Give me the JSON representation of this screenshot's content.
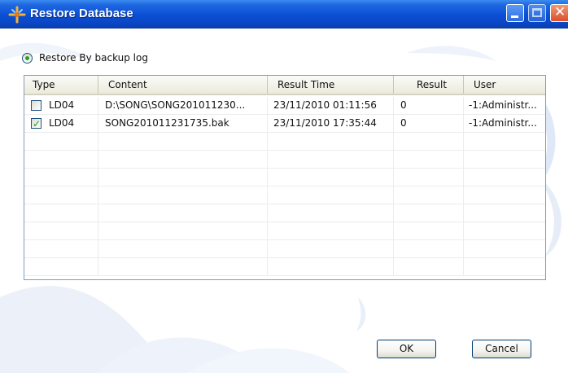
{
  "window": {
    "title": "Restore Database",
    "icon": "restore-database-icon",
    "controls": [
      "minimize-icon",
      "maximize-icon",
      "close-icon"
    ]
  },
  "restore_option": {
    "label": "Restore By backup log",
    "selected": true
  },
  "grid": {
    "columns": [
      "Type",
      "Content",
      "Result Time",
      "Result",
      "User"
    ],
    "rows": [
      {
        "checked": false,
        "type": "LD04",
        "content": "D:\\SONG\\SONG201011230...",
        "result_time": "23/11/2010 01:11:56",
        "result": "0",
        "user": "-1:Administr..."
      },
      {
        "checked": true,
        "type": "LD04",
        "content": "SONG201011231735.bak",
        "result_time": "23/11/2010 17:35:44",
        "result": "0",
        "user": "-1:Administr..."
      }
    ]
  },
  "buttons": {
    "ok": "OK",
    "cancel": "Cancel"
  },
  "colors": {
    "titlebar": "#0a4fd4",
    "checkmark": "#21a121",
    "grid_border": "#7f9db9"
  }
}
